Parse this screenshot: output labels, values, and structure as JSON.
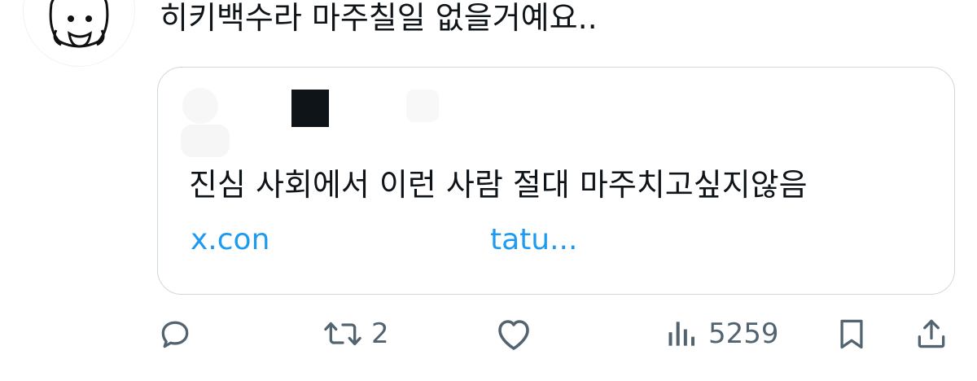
{
  "tweet": {
    "text": "히키백수라 마주칠일 없을거예요.."
  },
  "quote": {
    "text": "진심 사회에서 이런 사람 절대 마주치고싶지않음",
    "link_start": "x.con",
    "link_end": "tatu..."
  },
  "actions": {
    "retweet_count": "2",
    "views_count": "5259"
  },
  "colors": {
    "link": "#1d9bf0",
    "icon": "#536471",
    "border": "#cfd9de",
    "text": "#0f1419"
  }
}
